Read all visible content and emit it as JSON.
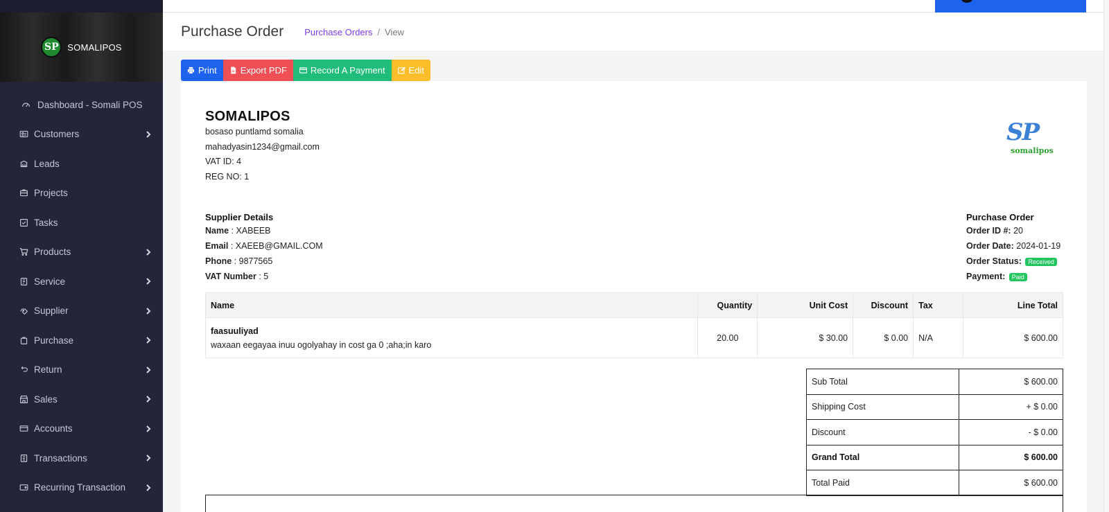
{
  "sidebar": {
    "brand_logo": "SP",
    "brand_name": "SOMALIPOS",
    "items": [
      {
        "label": "Dashboard - Somali POS",
        "icon": "dashboard-icon",
        "chevron": false
      },
      {
        "label": "Customers",
        "icon": "customers-icon",
        "chevron": true
      },
      {
        "label": "Leads",
        "icon": "leads-icon",
        "chevron": false
      },
      {
        "label": "Projects",
        "icon": "projects-icon",
        "chevron": false
      },
      {
        "label": "Tasks",
        "icon": "tasks-icon",
        "chevron": false
      },
      {
        "label": "Products",
        "icon": "cart-icon",
        "chevron": true
      },
      {
        "label": "Service",
        "icon": "service-icon",
        "chevron": true
      },
      {
        "label": "Supplier",
        "icon": "supplier-icon",
        "chevron": true
      },
      {
        "label": "Purchase",
        "icon": "purchase-icon",
        "chevron": true
      },
      {
        "label": "Return",
        "icon": "return-icon",
        "chevron": true
      },
      {
        "label": "Sales",
        "icon": "sales-icon",
        "chevron": true
      },
      {
        "label": "Accounts",
        "icon": "accounts-icon",
        "chevron": true
      },
      {
        "label": "Transactions",
        "icon": "transactions-icon",
        "chevron": true
      },
      {
        "label": "Recurring Transaction",
        "icon": "recurring-icon",
        "chevron": true
      }
    ]
  },
  "header": {
    "title": "Purchase Order",
    "breadcrumb_link": "Purchase Orders",
    "breadcrumb_sep": "/",
    "breadcrumb_current": "View"
  },
  "actions": {
    "print": "Print",
    "export_pdf": "Export PDF",
    "record_payment": "Record A Payment",
    "edit": "Edit"
  },
  "company": {
    "name": "SOMALIPOS",
    "address": "bosaso puntlamd somalia",
    "email": "mahadyasin1234@gmail.com",
    "vat": "VAT ID: 4",
    "reg": "REG NO: 1",
    "logo_letters": "SP",
    "logo_word": "somalipos"
  },
  "supplier": {
    "title": "Supplier Details",
    "name_label": "Name",
    "name": "XABEEB",
    "email_label": "Email",
    "email": "XAEEB@GMAIL.COM",
    "phone_label": "Phone",
    "phone": "9877565",
    "vat_label": "VAT Number",
    "vat": "5"
  },
  "order": {
    "title": "Purchase Order",
    "id_label": "Order ID #:",
    "id": "20",
    "date_label": "Order Date:",
    "date": "2024-01-19",
    "status_label": "Order Status:",
    "status": "Received",
    "payment_label": "Payment:",
    "payment": "Paid"
  },
  "items_table": {
    "headers": [
      "Name",
      "Quantity",
      "Unit Cost",
      "Discount",
      "Tax",
      "Line Total"
    ],
    "rows": [
      {
        "name": "faasuuliyad",
        "description": "waxaan eegayaa inuu ogolyahay in cost ga 0 ;aha;in karo",
        "quantity": "20.00",
        "unit_cost": "$ 30.00",
        "discount": "$ 0.00",
        "tax": "N/A",
        "line_total": "$ 600.00"
      }
    ]
  },
  "totals": {
    "sub_total_label": "Sub Total",
    "sub_total": "$ 600.00",
    "shipping_label": "Shipping Cost",
    "shipping": "+ $ 0.00",
    "discount_label": "Discount",
    "discount": "- $ 0.00",
    "grand_label": "Grand Total",
    "grand": "$ 600.00",
    "paid_label": "Total Paid",
    "paid": "$ 600.00"
  },
  "colors": {
    "sidebar_bg": "#23253a",
    "primary": "#1d63ee",
    "danger": "#ef4f55",
    "success": "#1fbd79",
    "warning": "#fbbe2a",
    "badge": "#22c55e",
    "breadcrumb_link": "#7c3aed"
  }
}
